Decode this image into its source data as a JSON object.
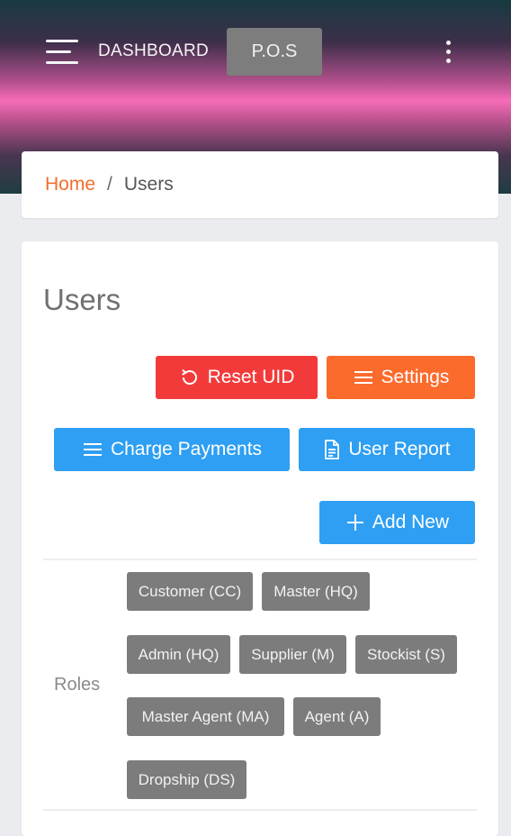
{
  "topbar": {
    "dashboard_label": "DASHBOARD",
    "pos_label": "P.O.S",
    "menu_icon": "hamburger-menu-icon",
    "more_icon": "vertical-dots-icon"
  },
  "breadcrumb": {
    "home": "Home",
    "separator": "/",
    "current": "Users"
  },
  "page": {
    "title": "Users"
  },
  "actions": {
    "reset_uid": "Reset UID",
    "settings": "Settings",
    "charge_payments": "Charge Payments",
    "user_report": "User Report",
    "add_new": "Add New"
  },
  "roles": {
    "label": "Roles",
    "items": [
      "Customer (CC)",
      "Master (HQ)",
      "Admin (HQ)",
      "Supplier (M)",
      "Stockist (S)",
      "Master Agent (MA)",
      "Agent (A)",
      "Dropship (DS)"
    ]
  },
  "colors": {
    "accent_orange": "#fb6b2c",
    "danger_red": "#f33a3a",
    "primary_blue": "#2e9ff2",
    "chip_gray": "#7c7c7c",
    "breadcrumb_link": "#f26d2d"
  }
}
